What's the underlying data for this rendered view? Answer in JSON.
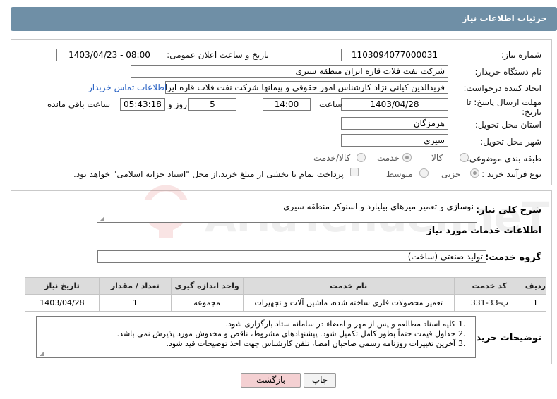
{
  "header": {
    "title": "جزئیات اطلاعات نیاز"
  },
  "form": {
    "need_number": {
      "label": "شماره نیاز:",
      "value": "1103094077000031"
    },
    "announce_datetime": {
      "label": "تاریخ و ساعت اعلان عمومی:",
      "value": "1403/04/23 - 08:00"
    },
    "buyer_org": {
      "label": "نام دستگاه خریدار:",
      "value": "شرکت نفت فلات قاره ایران منطقه سیری"
    },
    "requester": {
      "label": "ایجاد کننده درخواست:",
      "value": "فریدالدین کیانی نژاد کارشناس امور حقوقی و پیمانها شرکت نفت فلات قاره ایران"
    },
    "buyer_contact_link": "اطلاعات تماس خریدار",
    "deadline": {
      "label_line1": "مهلت ارسال پاسخ: تا",
      "label_line2": "تاریخ:",
      "date": "1403/04/28",
      "time_label": "ساعت",
      "time": "14:00",
      "days": "5",
      "days_label": "روز و",
      "remaining": "05:43:18",
      "remaining_label": "ساعت باقی مانده"
    },
    "province": {
      "label": "استان محل تحویل:",
      "value": "هرمزگان"
    },
    "city": {
      "label": "شهر محل تحویل:",
      "value": "سیری"
    },
    "category": {
      "label": "طبقه بندی موضوعی:",
      "options": [
        "کالا",
        "خدمت",
        "کالا/خدمت"
      ],
      "selected": "خدمت"
    },
    "purchase_type": {
      "label": "نوع فرآیند خرید :",
      "options": [
        "جزیی",
        "متوسط"
      ],
      "selected": "جزیی",
      "checkbox_text": "پرداخت تمام یا بخشی از مبلغ خرید،از محل \"اسناد خزانه اسلامی\" خواهد بود."
    }
  },
  "details": {
    "summary_label": "شرح کلی نیاز:",
    "summary_value": "نوسازی و تعمیر میزهای بیلیارد و اسنوکر منطقه سیری",
    "services_title": "اطلاعات خدمات مورد نیاز",
    "service_group_label": "گروه خدمت:",
    "service_group_value": "تولید صنعتی (ساخت)",
    "table": {
      "headers": [
        "ردیف",
        "کد خدمت",
        "نام خدمت",
        "واحد اندازه گیری",
        "تعداد / مقدار",
        "تاریخ نیاز"
      ],
      "rows": [
        [
          "1",
          "پ-33-331",
          "تعمیر محصولات فلزی ساخته شده، ماشین آلات و تجهیزات",
          "مجموعه",
          "1",
          "1403/04/28"
        ]
      ]
    },
    "buyer_notes_label": "توضیحات خریدار:",
    "buyer_notes": [
      "کلیه اسناد مطالعه و پس از مهر و امضاء در سامانه ستاد بارگزاری شود.",
      "جداول قیمت حتماً بطور کامل تکمیل شود. پیشنهادهای مشروط، ناقص و مخدوش مورد پذیرش نمی باشد.",
      "آخرین تغییرات روزنامه رسمی صاحبان امضا، تلفن کارشناس جهت اخذ توضیحات قید شود."
    ]
  },
  "buttons": {
    "print": "چاپ",
    "back": "بازگشت"
  },
  "watermark": {
    "text": "AriaTender.neT"
  },
  "colors": {
    "titlebar": "#6f8fa6",
    "link": "#2a63c4",
    "back_button": "#f4d0d2",
    "watermark": "#d9534f"
  }
}
